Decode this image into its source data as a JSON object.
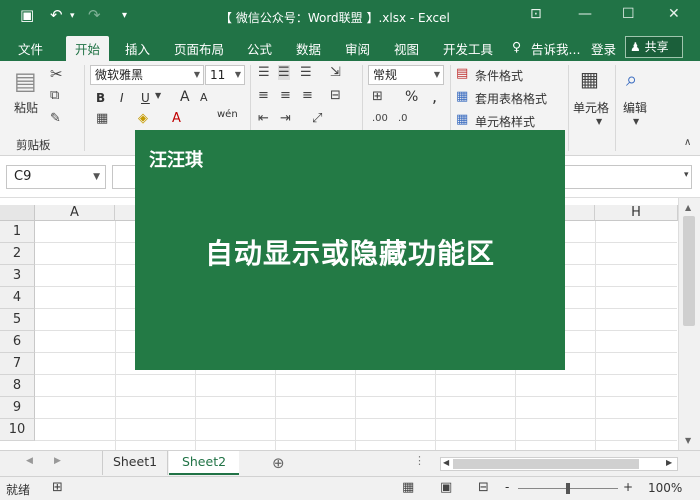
{
  "window": {
    "title": "【 微信公众号：Word联盟 】.xlsx - Excel",
    "quick_access": {
      "save_icon": "save-icon",
      "undo_icon": "undo-icon",
      "redo_icon": "redo-icon",
      "customize_icon": "customize-qat-icon"
    }
  },
  "tabs": [
    "文件",
    "开始",
    "插入",
    "页面布局",
    "公式",
    "数据",
    "审阅",
    "视图",
    "开发工具"
  ],
  "active_tab": "开始",
  "tell_me": "告诉我...",
  "login": "登录",
  "share": "共享",
  "ribbon": {
    "clipboard": {
      "paste": "粘贴",
      "group_label": "剪贴板"
    },
    "font": {
      "name": "微软雅黑",
      "size": "11",
      "bold": "B",
      "italic": "I",
      "underline": "U",
      "wen": "wén",
      "a_large": "A",
      "a_small": "A"
    },
    "number": {
      "format": "常规",
      "percent": "%",
      "comma": ","
    },
    "styles": {
      "conditional": "条件格式",
      "table": "套用表格格式",
      "cell": "单元格样式"
    },
    "cells_label": "单元格",
    "editing_label": "编辑"
  },
  "formula_bar": {
    "name_box": "C9"
  },
  "grid": {
    "columns": [
      "A",
      "H"
    ],
    "rows": [
      "1",
      "2",
      "3",
      "4",
      "5",
      "6",
      "7",
      "8",
      "9",
      "10"
    ]
  },
  "sheets": [
    "Sheet1",
    "Sheet2"
  ],
  "active_sheet": "Sheet2",
  "status": {
    "ready": "就绪",
    "zoom": "100%",
    "minus": "-",
    "plus": "+"
  },
  "overlay": {
    "author": "汪汪琪",
    "caption": "自动显示或隐藏功能区"
  },
  "colors": {
    "excel_green": "#217346",
    "overlay_green": "#237a45"
  }
}
